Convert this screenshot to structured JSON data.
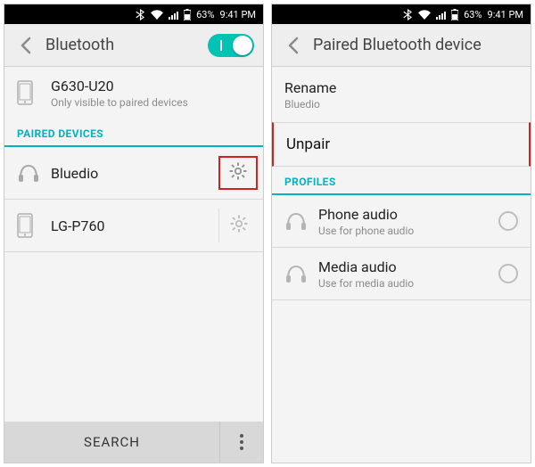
{
  "status": {
    "battery": "63%",
    "time": "9:41 PM"
  },
  "left": {
    "title": "Bluetooth",
    "toggle_on": true,
    "local_device": {
      "name": "G630-U20",
      "visibility": "Only visible to paired devices"
    },
    "section_paired": "PAIRED DEVICES",
    "devices": [
      {
        "name": "Bluedio",
        "type": "headphones",
        "highlighted_gear": true
      },
      {
        "name": "LG-P760",
        "type": "phone",
        "highlighted_gear": false
      }
    ],
    "search_label": "SEARCH"
  },
  "right": {
    "title": "Paired Bluetooth device",
    "rename_label": "Rename",
    "device_name": "Bluedio",
    "unpair_label": "Unpair",
    "unpair_highlighted": true,
    "section_profiles": "PROFILES",
    "profiles": [
      {
        "title": "Phone audio",
        "subtitle": "Use for phone audio",
        "checked": false
      },
      {
        "title": "Media audio",
        "subtitle": "Use for media audio",
        "checked": false
      }
    ]
  }
}
